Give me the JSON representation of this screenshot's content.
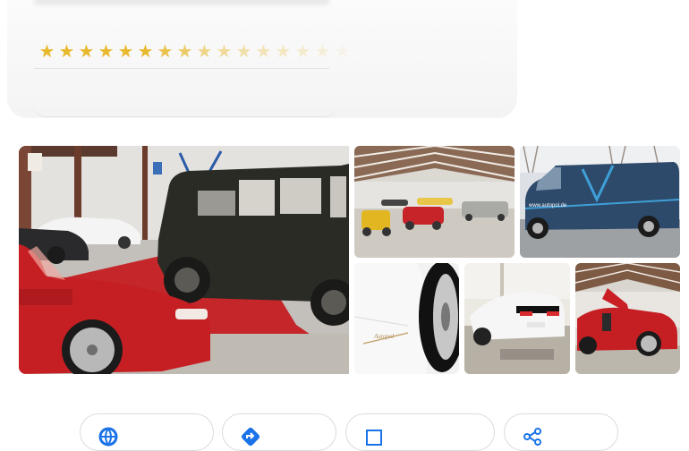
{
  "rating": {
    "stars": [
      "★",
      "★",
      "★",
      "★",
      "★",
      "★",
      "★",
      "★",
      "★",
      "★",
      "★",
      "★",
      "★",
      "★",
      "★",
      "★"
    ]
  },
  "photos": [
    {
      "name": "photo-showroom-mercedes-sls-g-wagon",
      "alt": ""
    },
    {
      "name": "photo-warehouse-collection",
      "alt": ""
    },
    {
      "name": "photo-delivery-van",
      "alt": ""
    },
    {
      "name": "photo-wheel-closeup",
      "alt": ""
    },
    {
      "name": "photo-white-corvette",
      "alt": ""
    },
    {
      "name": "photo-red-gullwing",
      "alt": ""
    }
  ],
  "van": {
    "sign_text": "www.autopol.de"
  },
  "actions": [
    {
      "icon": "globe-icon",
      "label": ""
    },
    {
      "icon": "directions-icon",
      "label": ""
    },
    {
      "icon": "save-icon",
      "label": ""
    },
    {
      "icon": "share-icon",
      "label": ""
    }
  ],
  "colors": {
    "star": "#e8b92d",
    "accent": "#1a73e8",
    "car_red": "#c51f24"
  }
}
